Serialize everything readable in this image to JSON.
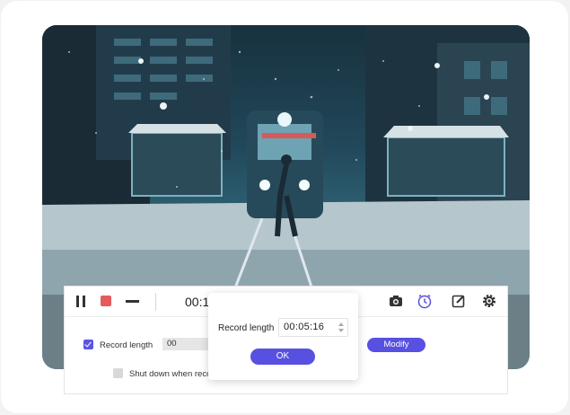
{
  "toolbar": {
    "timer_text": "00:1",
    "icons": [
      "pause-icon",
      "stop-icon",
      "minimize-icon",
      "camera-icon",
      "clock-icon",
      "edit-icon",
      "gear-icon"
    ]
  },
  "settings": {
    "record_length_label": "Record length",
    "record_length_checked": true,
    "record_length_value": "00",
    "shutdown_label": "Shut down when reco",
    "shutdown_checked": false,
    "modify_label": "Modify"
  },
  "dialog": {
    "label": "Record length",
    "time_value": "00:05:16",
    "ok_label": "OK"
  },
  "colors": {
    "accent": "#5850e0",
    "stop": "#e45b5b"
  }
}
